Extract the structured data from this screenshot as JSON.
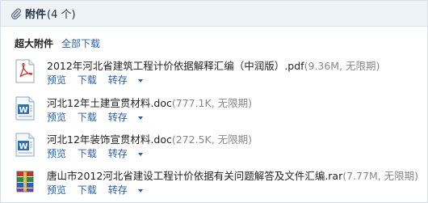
{
  "header": {
    "title": "附件",
    "count": "(4 个)"
  },
  "subbar": {
    "super_attachments_label": "超大附件",
    "download_all_label": "全部下载"
  },
  "files": [
    {
      "name": "2012年河北省建筑工程计价依据解释汇编（中润版）.pdf",
      "meta": "(9.36M, 无限期)",
      "type_icon": "pdf-icon",
      "preview": "预览",
      "download": "下载",
      "save": "转存"
    },
    {
      "name": "河北12年土建宣贯材料.doc",
      "meta": "(777.1K, 无限期)",
      "type_icon": "word-doc-icon",
      "preview": "预览",
      "download": "下载",
      "save": "转存"
    },
    {
      "name": "河北12年装饰宣贯材料.doc",
      "meta": "(272.5K, 无限期)",
      "type_icon": "word-doc-icon",
      "preview": "预览",
      "download": "下载",
      "save": "转存"
    },
    {
      "name": "唐山市2012河北省建设工程计价依据有关问题解答及文件汇编.rar",
      "meta": "(7.77M, 无限期)",
      "type_icon": "rar-archive-icon",
      "preview": "预览",
      "download": "下载",
      "save": "转存"
    }
  ]
}
